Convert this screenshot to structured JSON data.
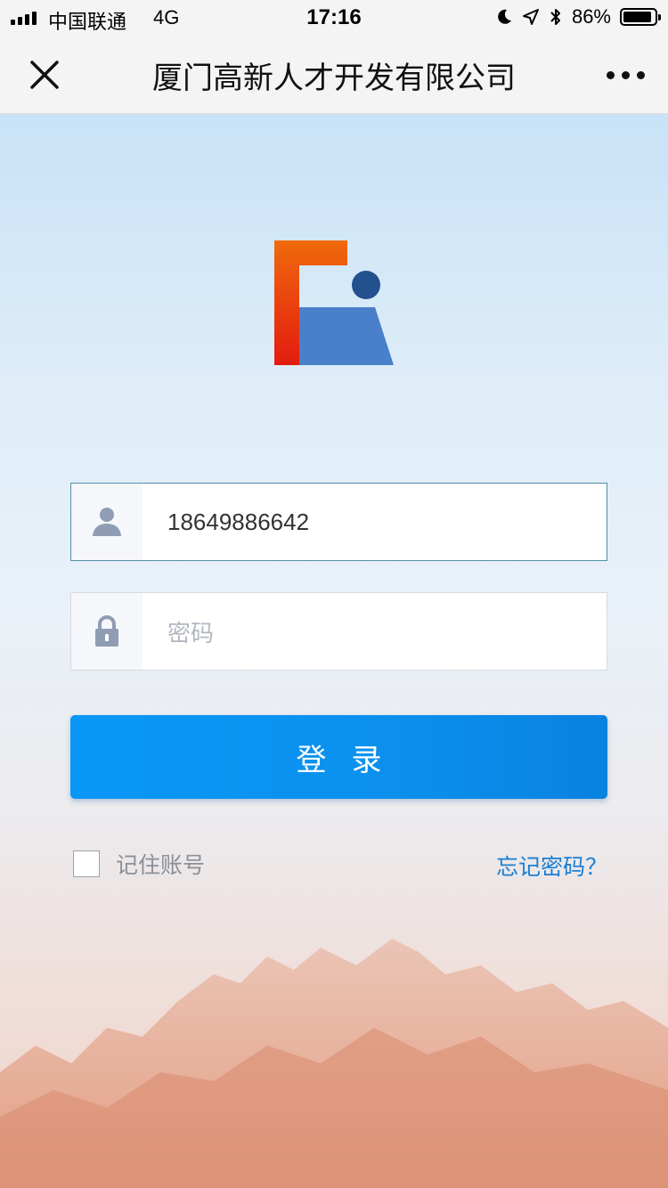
{
  "status_bar": {
    "carrier": "中国联通",
    "network": "4G",
    "time": "17:16",
    "battery": "86%"
  },
  "nav": {
    "title": "厦门高新人才开发有限公司"
  },
  "form": {
    "username_value": "18649886642",
    "password_placeholder": "密码",
    "login_label": "登录",
    "remember_label": "记住账号",
    "forgot_label": "忘记密码？"
  },
  "colors": {
    "accent": "#0a8ef0",
    "logo_orange": "#f06a0c",
    "logo_red": "#e31b10",
    "logo_blue": "#4a7fc9",
    "logo_dark_blue": "#23508f"
  },
  "icons": [
    "user-icon",
    "lock-icon",
    "close-icon",
    "more-icon",
    "moon-icon",
    "location-icon",
    "bluetooth-icon",
    "battery-icon",
    "signal-icon"
  ]
}
